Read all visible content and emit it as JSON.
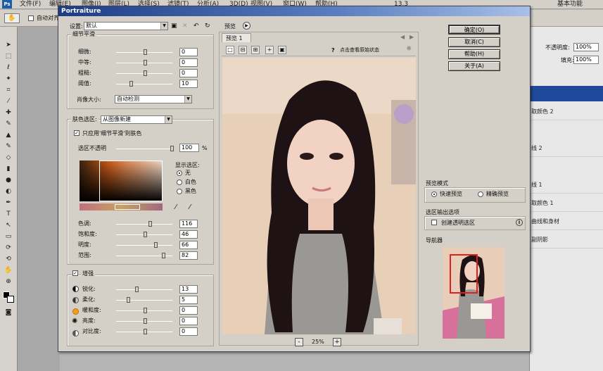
{
  "menubar": {
    "items": [
      "文件(F)",
      "编辑(E)",
      "图像(I)",
      "图层(L)",
      "选择(S)",
      "滤镜(T)",
      "分析(A)",
      "3D(D)",
      "视图(V)",
      "窗口(W)",
      "帮助(H)"
    ],
    "zoom": "13.3",
    "workspace": "基本功能"
  },
  "optbar": {
    "autoselect_label": "自动对齐所有"
  },
  "right_panel": {
    "opacity_label": "不透明度:",
    "opacity_value": "100%",
    "fill_label": "填充:",
    "fill_value": "100%",
    "layers": [
      "取颜色 2",
      "线 2",
      "线 1",
      "取颜色 1",
      "曲线和身材",
      "副阴影"
    ]
  },
  "dialog": {
    "title": "Portraiture",
    "settings_label": "设置:",
    "settings_value": "默认",
    "preview_label": "预览",
    "preview_tab": "预览 1",
    "click_hint": "点击查看原始状态",
    "buttons": {
      "ok": "确定(O)",
      "cancel": "取消(C)",
      "help": "帮助(H)",
      "about": "关于(A)"
    },
    "detail_group": {
      "title": "细节平滑",
      "rows": [
        {
          "label": "细微:",
          "value": "0",
          "level": 0.5
        },
        {
          "label": "中等:",
          "value": "0",
          "level": 0.5
        },
        {
          "label": "粗糙:",
          "value": "0",
          "level": 0.5
        },
        {
          "label": "阈值:",
          "value": "10",
          "level": 0.25
        }
      ],
      "portrait_size_label": "肖像大小:",
      "portrait_size_value": "自动检测"
    },
    "skin_group": {
      "title": "肤色选区:",
      "source_value": "从图像新建",
      "apply_only_label": "只应用'细节平滑'到肤色",
      "opacity_label": "选区不透明",
      "opacity_value": "100",
      "opacity_unit": "%",
      "display_label": "显示选区:",
      "display_options": [
        "无",
        "白色",
        "黑色"
      ],
      "rows": [
        {
          "label": "色调:",
          "value": "116",
          "level": 0.6
        },
        {
          "label": "饱和度:",
          "value": "46",
          "level": 0.5
        },
        {
          "label": "明度:",
          "value": "66",
          "level": 0.7
        },
        {
          "label": "范围:",
          "value": "82",
          "level": 0.85
        }
      ]
    },
    "enhance_group": {
      "title": "增强",
      "rows": [
        {
          "label": "锐化:",
          "value": "13",
          "level": 0.35
        },
        {
          "label": "柔化:",
          "value": "5",
          "level": 0.2
        },
        {
          "label": "暖和度:",
          "value": "0",
          "level": 0.5
        },
        {
          "label": "亮度:",
          "value": "0",
          "level": 0.5
        },
        {
          "label": "对比度:",
          "value": "0",
          "level": 0.5
        }
      ]
    },
    "zoom_value": "25%",
    "preview_mode": {
      "title": "预览模式",
      "options": [
        "快速预览",
        "精确预览"
      ]
    },
    "output": {
      "title": "选区输出选项",
      "create_label": "创建透明选区"
    },
    "navigator_title": "导航器"
  },
  "colors": {
    "dialog_bg": "#d4d0c8",
    "titlebar": "#1c3c86",
    "accent": "#1c5ea8"
  }
}
